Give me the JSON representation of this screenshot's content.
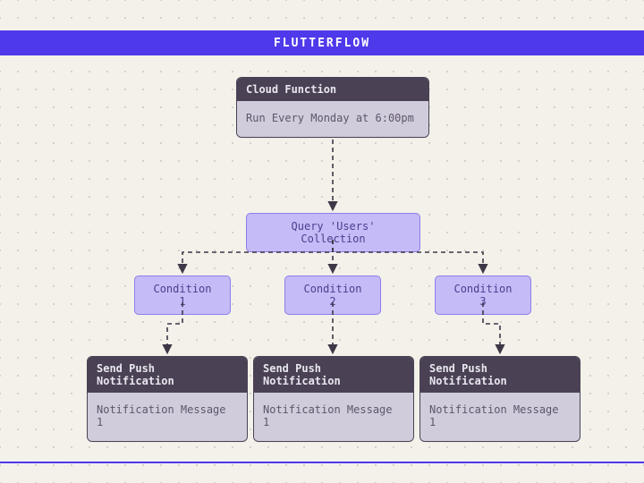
{
  "banner": {
    "title": "FLUTTERFLOW"
  },
  "cloud_function": {
    "title": "Cloud Function",
    "schedule": "Run Every Monday at 6:00pm"
  },
  "query": {
    "label": "Query 'Users' Collection"
  },
  "conditions": [
    {
      "label": "Condition 1"
    },
    {
      "label": "Condition 2"
    },
    {
      "label": "Condition 3"
    }
  ],
  "notifications": [
    {
      "title": "Send Push Notification",
      "message": "Notification Message 1"
    },
    {
      "title": "Send Push Notification",
      "message": "Notification Message 1"
    },
    {
      "title": "Send Push Notification",
      "message": "Notification Message 1"
    }
  ],
  "colors": {
    "brand": "#4E39EB",
    "node_header": "#4A4254",
    "node_body": "#D1CCDB",
    "chip_bg": "#C5BBF6",
    "chip_border": "#8E7EEA"
  }
}
